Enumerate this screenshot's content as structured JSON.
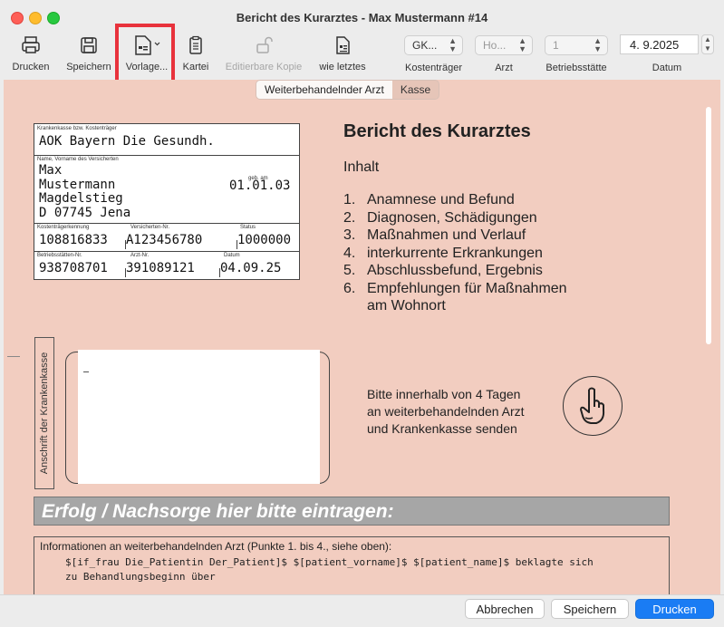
{
  "window": {
    "title": "Bericht des Kurarztes -  Max Mustermann #14"
  },
  "toolbar": {
    "print": "Drucken",
    "save": "Speichern",
    "template": "Vorlage...",
    "card": "Kartei",
    "editable_copy": "Editierbare Kopie",
    "like_last": "wie letztes",
    "payer": {
      "label": "Kostenträger",
      "value": "GK..."
    },
    "doctor": {
      "label": "Arzt",
      "value": "Ho..."
    },
    "site": {
      "label": "Betriebsstätte",
      "value": "1"
    },
    "date": {
      "label": "Datum",
      "value": "4. 9.2025"
    }
  },
  "tabs": [
    "Weiterbehandelnder Arzt",
    "Kasse"
  ],
  "insurance_card": {
    "insurer_label": "Krankenkasse bzw. Kostenträger",
    "insurer": "AOK Bayern Die Gesundh.",
    "name_label": "Name, Vorname des Versicherten",
    "first_name": "Max",
    "last_name": "Mustermann",
    "dob_label": "geb. am",
    "dob": "01.01.03",
    "street": "Magdelstieg",
    "city": "D 07745 Jena",
    "payer_id_label": "Kostenträgerkennung",
    "payer_id": "108816833",
    "insured_no_label": "Versicherten-Nr.",
    "insured_no": "A123456780",
    "status_label": "Status",
    "status": "1000000",
    "site_no_label": "Betriebsstätten-Nr.",
    "site_no": "938708701",
    "doctor_no_label": "Arzt-Nr.",
    "doctor_no": "391089121",
    "date_label": "Datum",
    "date": "04.09.25"
  },
  "report": {
    "heading": "Bericht des Kurarztes",
    "contents_label": "Inhalt",
    "items": [
      {
        "n": "1.",
        "text": "Anamnese und Befund"
      },
      {
        "n": "2.",
        "text": "Diagnosen, Schädigungen"
      },
      {
        "n": "3.",
        "text": "Maßnahmen und Verlauf"
      },
      {
        "n": "4.",
        "text": "interkurrente Erkrankungen"
      },
      {
        "n": "5.",
        "text": "Abschlussbefund, Ergebnis"
      },
      {
        "n": "6.",
        "text": "Empfehlungen für Maßnahmen"
      },
      {
        "n": "",
        "text": "am Wohnort"
      }
    ]
  },
  "address": {
    "vertical_label": "Anschrift der Krankenkasse"
  },
  "send_note": [
    "Bitte innerhalb von 4 Tagen",
    "an weiterbehandelnden Arzt",
    "und Krankenkasse senden"
  ],
  "banner": "Erfolg / Nachsorge hier bitte eintragen:",
  "info": {
    "label": "Informationen an weiterbehandelnden Arzt (Punkte 1. bis 4., siehe oben):",
    "template_line1": "$[if_frau Die_Patientin Der_Patient]$ $[patient_vorname]$ $[patient_name]$ beklagte sich",
    "template_line2": "zu Behandlungsbeginn über"
  },
  "footer": {
    "cancel": "Abbrechen",
    "save": "Speichern",
    "print": "Drucken"
  },
  "colors": {
    "content_bg": "#f2cdc0",
    "primary_button": "#1a7cf4",
    "highlight": "#e8323c"
  }
}
